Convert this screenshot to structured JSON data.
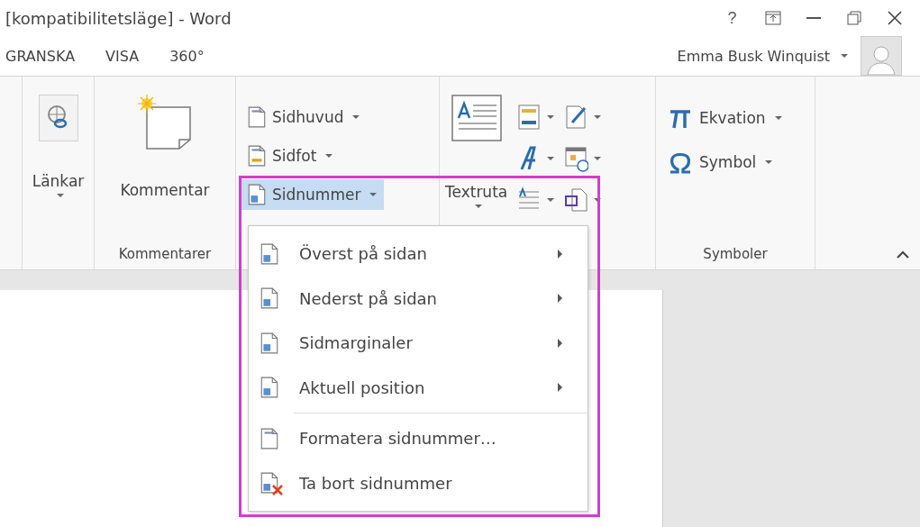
{
  "window": {
    "title": "[kompatibilitetsläge] - Word",
    "help": "?"
  },
  "tabs": [
    {
      "label": "GRANSKA",
      "selected": false
    },
    {
      "label": "VISA",
      "selected": false
    },
    {
      "label": "360°",
      "selected": false
    }
  ],
  "user": {
    "name": "Emma Busk Winquist"
  },
  "ribbon": {
    "groups": [
      {
        "kind": "blank"
      },
      {
        "kind": "large",
        "buttons": [
          {
            "label": "Länkar",
            "dropdown": true
          }
        ]
      },
      {
        "kind": "large",
        "label": "Kommentarer",
        "buttons": [
          {
            "label": "Kommentar",
            "dropdown": false
          }
        ]
      },
      {
        "kind": "stack",
        "buttons": [
          {
            "label": "Sidhuvud",
            "dropdown": true,
            "selected": false
          },
          {
            "label": "Sidfot",
            "dropdown": true,
            "selected": false
          },
          {
            "label": "Sidnummer",
            "dropdown": true,
            "selected": true
          }
        ]
      },
      {
        "kind": "text",
        "buttons": [
          {
            "label": "Textruta",
            "dropdown": true
          }
        ]
      },
      {
        "kind": "symbols",
        "label": "Symboler",
        "buttons": [
          {
            "label": "Ekvation",
            "dropdown": true
          },
          {
            "label": "Symbol",
            "dropdown": true
          }
        ]
      }
    ]
  },
  "menu": {
    "items": [
      {
        "label": "Överst på sidan",
        "submenu": true,
        "separator_before": false
      },
      {
        "label": "Nederst på sidan",
        "submenu": true,
        "separator_before": false
      },
      {
        "label": "Sidmarginaler",
        "submenu": true,
        "separator_before": false
      },
      {
        "label": "Aktuell position",
        "submenu": true,
        "separator_before": false
      },
      {
        "label": "Formatera sidnummer…",
        "submenu": false,
        "separator_before": true
      },
      {
        "label": "Ta bort sidnummer",
        "submenu": false,
        "separator_before": false
      }
    ]
  }
}
